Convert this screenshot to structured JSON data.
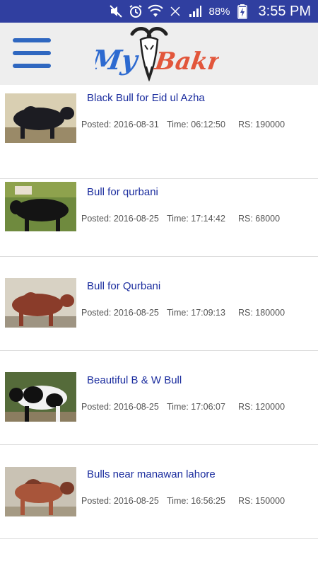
{
  "status_bar": {
    "battery_percent": "88%",
    "time": "3:55 PM",
    "icons": [
      "mute-icon",
      "alarm-icon",
      "wifi-icon",
      "no-signal-icon",
      "cell-signal-icon",
      "battery-charging-icon"
    ]
  },
  "app_bar": {
    "menu_icon": "hamburger-menu-icon",
    "logo": {
      "part1": "My",
      "part2": "Bakra"
    }
  },
  "colors": {
    "status_bar": "#303fa0",
    "app_bar": "#eeeeee",
    "menu_icon": "#2f67c0",
    "title": "#1a2c9e",
    "meta": "#555555"
  },
  "listings": [
    {
      "title": "Black Bull for Eid ul Azha",
      "posted": "Posted: 2016-08-31",
      "time": "Time: 06:12:50",
      "price": "RS: 190000"
    },
    {
      "title": "Bull for qurbani",
      "posted": "Posted: 2016-08-25",
      "time": "Time: 17:14:42",
      "price": "RS: 68000"
    },
    {
      "title": "Bull for Qurbani",
      "posted": "Posted: 2016-08-25",
      "time": "Time: 17:09:13",
      "price": "RS: 180000"
    },
    {
      "title": "Beautiful B & W Bull",
      "posted": "Posted: 2016-08-25",
      "time": "Time: 17:06:07",
      "price": "RS: 120000"
    },
    {
      "title": "Bulls near manawan lahore",
      "posted": "Posted: 2016-08-25",
      "time": "Time: 16:56:25",
      "price": "RS: 150000"
    }
  ]
}
